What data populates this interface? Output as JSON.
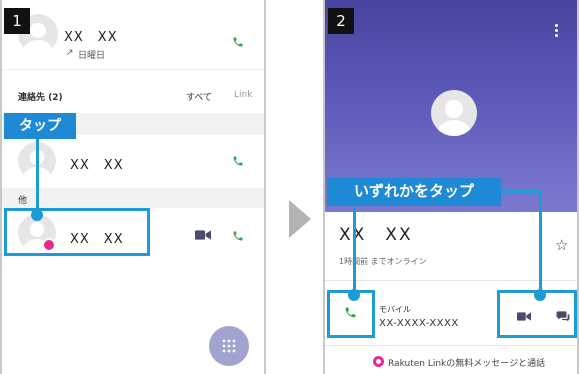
{
  "step1": {
    "number": "1",
    "recent_call": {
      "name": "XX　XX",
      "detail": "日曜日",
      "detail_arrow": "↗"
    },
    "contacts_section": {
      "title": "連絡先 (2)",
      "filter_all": "すべて",
      "filter_link": "Link"
    },
    "tap_badge": "タップ",
    "contact_1": {
      "name": "XX　XX"
    },
    "others_section": {
      "title": "他"
    },
    "contact_2": {
      "name": "XX　XX"
    }
  },
  "step2": {
    "number": "2",
    "select_badge": "いずれかをタップ",
    "contact_name": "XX　XX",
    "status": "1時間前 までオンライン",
    "mobile_label": "モバイル",
    "mobile_number": "XX-XXXX-XXXX",
    "footer": "Rakuten Linkの無料メッセージと通話"
  },
  "colors": {
    "highlight": "#1e9ad6",
    "badge": "#1e8ad6",
    "call_green": "#2fa54a",
    "header_purple": "#5c5ab8",
    "fab": "#a3a3d1",
    "rakuten_pink": "#e8298e"
  },
  "icons": [
    "phone-icon",
    "video-icon",
    "chat-icon",
    "star-icon",
    "dialpad-icon",
    "more-icon",
    "rakuten-link-icon",
    "next-arrow-icon"
  ]
}
